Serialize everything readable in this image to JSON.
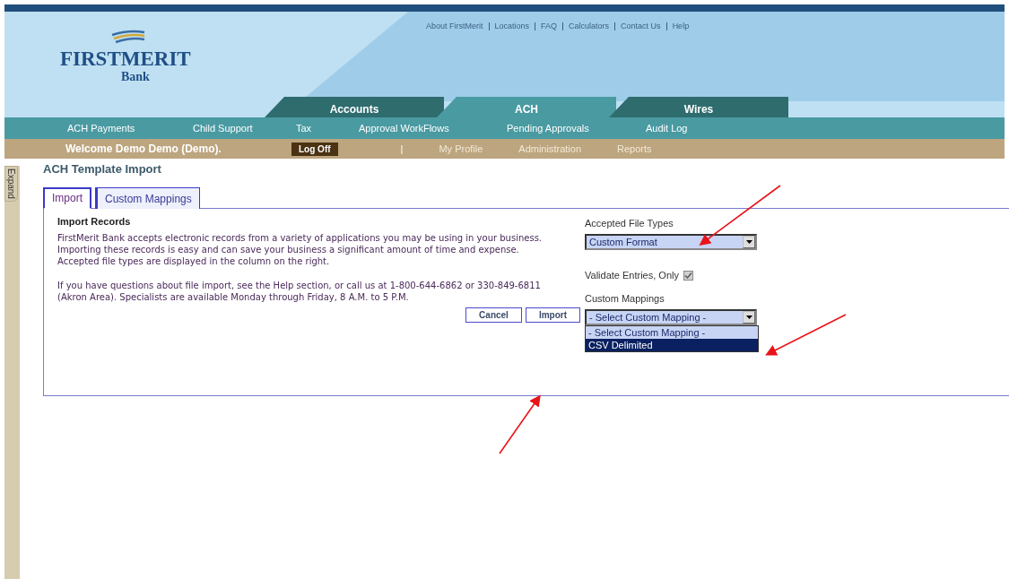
{
  "top_links": [
    "About FirstMerit",
    "Locations",
    "FAQ",
    "Calculators",
    "Contact Us",
    "Help"
  ],
  "logo": {
    "name": "FIRSTMERIT",
    "sub": "Bank"
  },
  "main_tabs": [
    {
      "label": "Accounts",
      "selected": false
    },
    {
      "label": "ACH",
      "selected": true
    },
    {
      "label": "Wires",
      "selected": false
    }
  ],
  "sub_nav": [
    "ACH Payments",
    "Child Support",
    "Tax",
    "Approval WorkFlows",
    "Pending Approvals",
    "Audit Log"
  ],
  "user_bar": {
    "welcome": "Welcome Demo Demo (Demo).",
    "log_off": "Log Off",
    "separator": "|",
    "links": [
      "My Profile",
      "Administration",
      "Reports"
    ]
  },
  "sidebar": {
    "label": "Expand"
  },
  "page_title": "ACH Template Import",
  "tabs": [
    {
      "label": "Import",
      "selected": true
    },
    {
      "label": "Custom Mappings",
      "selected": false
    }
  ],
  "panel": {
    "heading": "Import Records",
    "paragraphs": [
      "FirstMerit Bank accepts electronic records from a variety of applications you may be using in your business. Importing these records is easy and can save your business a significant amount of time and expense. Accepted file types are displayed in the column on the right.",
      "If you have questions about file import, see the Help section, or call us at 1-800-644-6862 or 330-849-6811 (Akron Area). Specialists are available Monday through Friday, 8 A.M. to 5 P.M."
    ],
    "buttons": [
      "Cancel",
      "Import"
    ],
    "accepted_file_types": {
      "label": "Accepted File Types",
      "value": "Custom Format"
    },
    "validate": {
      "label": "Validate Entries, Only",
      "checked": true
    },
    "custom_mappings": {
      "label": "Custom Mappings",
      "value": "- Select Custom Mapping -",
      "expanded": true,
      "options": [
        {
          "label": "- Select Custom Mapping -",
          "highlighted": false
        },
        {
          "label": "CSV Delimited",
          "highlighted": true
        }
      ]
    }
  }
}
